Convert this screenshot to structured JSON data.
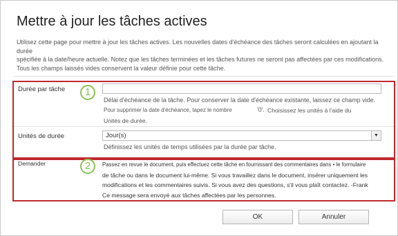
{
  "title": "Mettre à jour les tâches actives",
  "intro": {
    "line1": "Utilisez cette page pour mettre à jour les tâches actives. Les nouvelles dates d'échéance des tâches seront calculées en ajoutant la durée",
    "line2": "spécifiée à la date/heure actuelle. Notez que les tâches terminées et les tâches futures ne seront pas affectées par ces modifications.",
    "line3": "Tous les champs laissés vides conservent la valeur définie pour cette tâche."
  },
  "duration": {
    "label": "Durée par tâche",
    "badge": "1",
    "value": "",
    "help_line1": "Délai d'échéance de la tâche. Pour conserver la date d'échéance existante, laissez ce champ vide.",
    "help_line2a": "Pour supprimer la date d'échéance, tapez le nombre",
    "help_zero": "'0'.",
    "help_line2b": "Choisissez les unités à l'aide du",
    "help_line3": "Unités de durée."
  },
  "units": {
    "label": "Unités de durée",
    "selected": "Jour(s)",
    "help": "Définissez les unités de temps utilisées par la durée par tâche."
  },
  "request": {
    "label": "Demander",
    "badge": "2",
    "line1": "Passez en revue le document, puis effectuez cette tâche en fournissant des commentaires dans • le formulaire",
    "line2": "de tâche ou dans le document lui-même. Si vous travaillez dans le document, insérer uniquement les",
    "line3": "modifications et les commentaires suivis. Si vous avez des questions, s'il vous plaît contactez. -Frank",
    "line4": "Ce message sera envoyé aux tâches affectées par les personnes."
  },
  "buttons": {
    "ok": "OK",
    "cancel": "Annuler"
  },
  "colors": {
    "highlight_border": "#c0282d",
    "badge": "#8cc152"
  }
}
